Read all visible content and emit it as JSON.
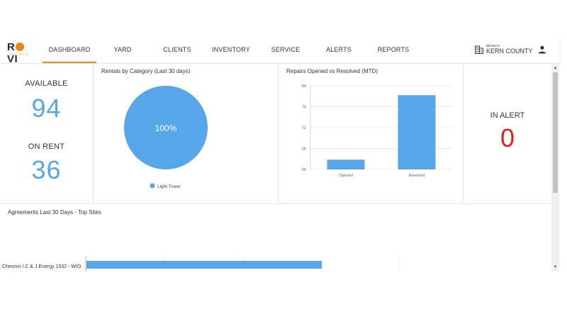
{
  "brand": {
    "name_a": "R",
    "name_b": "VI",
    "tagline": "TRACKER",
    "accent": "#e8860f"
  },
  "nav": {
    "tabs": [
      {
        "label": "DASHBOARD",
        "active": true
      },
      {
        "label": "YARD",
        "active": false
      },
      {
        "label": "CLIENTS",
        "active": false
      },
      {
        "label": "INVENTORY",
        "active": false
      },
      {
        "label": "SERVICE",
        "active": false
      },
      {
        "label": "ALERTS",
        "active": false
      },
      {
        "label": "REPORTS",
        "active": false
      }
    ],
    "branch_label": "BRANCH",
    "branch_name": "KERN COUNTY"
  },
  "stats": {
    "available_label": "AVAILABLE",
    "available_value": "94",
    "on_rent_label": "ON RENT",
    "on_rent_value": "36"
  },
  "alert": {
    "label": "IN ALERT",
    "value": "0"
  },
  "rentals": {
    "title": "Rentals by Category (Last 30 days)"
  },
  "repairs": {
    "title": "Repairs Opened vs Resolved (MTD)"
  },
  "agreements": {
    "title": "Agreements Last 30 Days - Top Sites"
  },
  "colors": {
    "primary": "#57a7e8",
    "alert": "#e02020",
    "active_tab": "#f28a1f"
  },
  "chart_data": [
    {
      "type": "pie",
      "title": "Rentals by Category (Last 30 days)",
      "categories": [
        "Light Tower"
      ],
      "values": [
        100
      ],
      "data_labels": [
        "100%"
      ],
      "legend": "bottom"
    },
    {
      "type": "bar",
      "title": "Repairs Opened vs Resolved (MTD)",
      "categories": [
        "Opened",
        "Resolved"
      ],
      "values": [
        62.8,
        81.3
      ],
      "y_ticks": [
        60,
        66,
        72,
        78,
        84
      ],
      "ylim": [
        60,
        84
      ],
      "grid": true
    },
    {
      "type": "bar",
      "orientation": "horizontal",
      "title": "Agreements Last 30 Days - Top Sites",
      "categories": [
        "Chevron / C & J Energy 1532 - W/O"
      ],
      "values": [
        1
      ]
    }
  ]
}
